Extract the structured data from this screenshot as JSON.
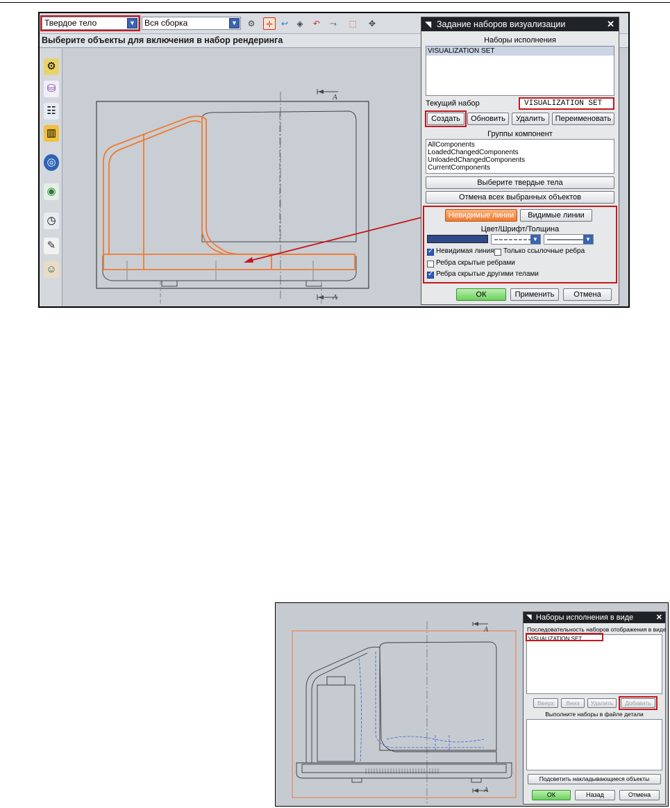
{
  "screen1": {
    "toolbar": {
      "type_filter": "Твердое тело",
      "scope_filter": "Вся сборка"
    },
    "prompt": "Выберите объекты для включения в набор рендеринга",
    "section_mark": "A",
    "dialog": {
      "title": "Задание наборов визуализации",
      "sets_label": "Наборы исполнения",
      "sets": [
        "VISUALIZATION SET"
      ],
      "current_set_label": "Текущий набор",
      "current_set_value": "VISUALIZATION SET",
      "buttons": [
        "Создать",
        "Обновить",
        "Удалить",
        "Переименовать"
      ],
      "groups_label": "Группы компонент",
      "groups": [
        "AllComponents",
        "LoadedChangedComponents",
        "UnloadedChangedComponents",
        "CurrentComponents"
      ],
      "select_bodies": "Выберите твердые тела",
      "deselect_all": "Отмена всех выбранных объектов",
      "tab_hidden": "Невидимые линии",
      "tab_visible": "Видимые линии",
      "style_label": "Цвет/Шрифт/Толщина",
      "options": {
        "hidden_line": "Невидимая линия",
        "ref_edges_only": "Только ссылочные ребра",
        "hidden_by_edges": "Ребра скрытые ребрами",
        "hidden_by_bodies": "Ребра скрытые другими телами"
      },
      "ok": "ОК",
      "apply": "Применить",
      "cancel": "Отмена"
    }
  },
  "screen2": {
    "section_mark": "A",
    "dialog": {
      "title": "Наборы исполнения в виде",
      "sequence_label": "Последовательность наборов отображения в виде",
      "sequence": [
        "VISUALIZATION SET"
      ],
      "up": "Вверх",
      "down": "Вниз",
      "delete": "Удалить",
      "add": "Добавить",
      "file_sets_label": "Выполните наборы в файле детали",
      "highlight": "Подсветить накладывающиеся объекты",
      "ok": "ОК",
      "back": "Назад",
      "cancel": "Отмена"
    }
  },
  "colors": {
    "highlight_red": "#c4161c",
    "selection_orange": "#f07a32",
    "dialog_title_bg": "#1f2226"
  }
}
